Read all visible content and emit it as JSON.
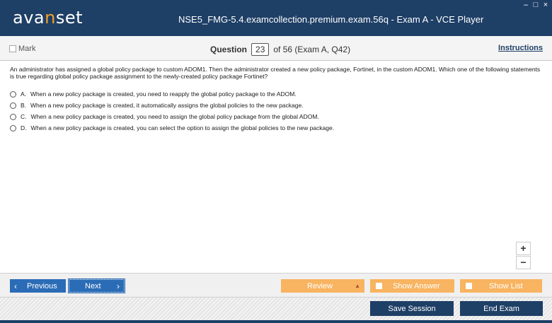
{
  "app": {
    "logo_prefix": "ava",
    "logo_accent": "n",
    "logo_suffix": "set",
    "window_title": "NSE5_FMG-5.4.examcollection.premium.exam.56q - Exam A - VCE Player",
    "window_controls": {
      "minimize": "–",
      "restore": "□",
      "close": "×"
    }
  },
  "header": {
    "mark_label": "Mark",
    "question_label": "Question",
    "question_number": "23",
    "question_of": "of 56 (Exam A, Q42)",
    "instructions_label": "Instructions"
  },
  "question": {
    "text": "An administrator has assigned a global policy package to custom ADOM1. Then the administrator created a new policy package, Fortinet, in the custom ADOM1. Which one of the following statements is true regarding global policy package assignment to the newly-created policy package Fortinet?",
    "options": [
      {
        "letter": "A.",
        "text": "When a new policy package is created, you need to reapply the global policy package to the ADOM."
      },
      {
        "letter": "B.",
        "text": "When a new policy package is created, it automatically assigns the global policies to the new package."
      },
      {
        "letter": "C.",
        "text": "When a new policy package is created, you need to assign the global policy package from the global ADOM."
      },
      {
        "letter": "D.",
        "text": "When a new policy package is created, you can select the option to assign the global policies to the new package."
      }
    ]
  },
  "zoom": {
    "zoom_in": "+",
    "zoom_out": "−",
    "search_icon": "magnifier-icon"
  },
  "nav": {
    "previous_label": "Previous",
    "next_label": "Next",
    "review_label": "Review",
    "show_answer_label": "Show Answer",
    "show_list_label": "Show List"
  },
  "footer": {
    "save_session_label": "Save Session",
    "end_exam_label": "End Exam"
  },
  "colors": {
    "titlebar": "#1e3f66",
    "nav_blue": "#2b6cb6",
    "orange": "#f8b460",
    "logo_accent": "#f5a028"
  }
}
